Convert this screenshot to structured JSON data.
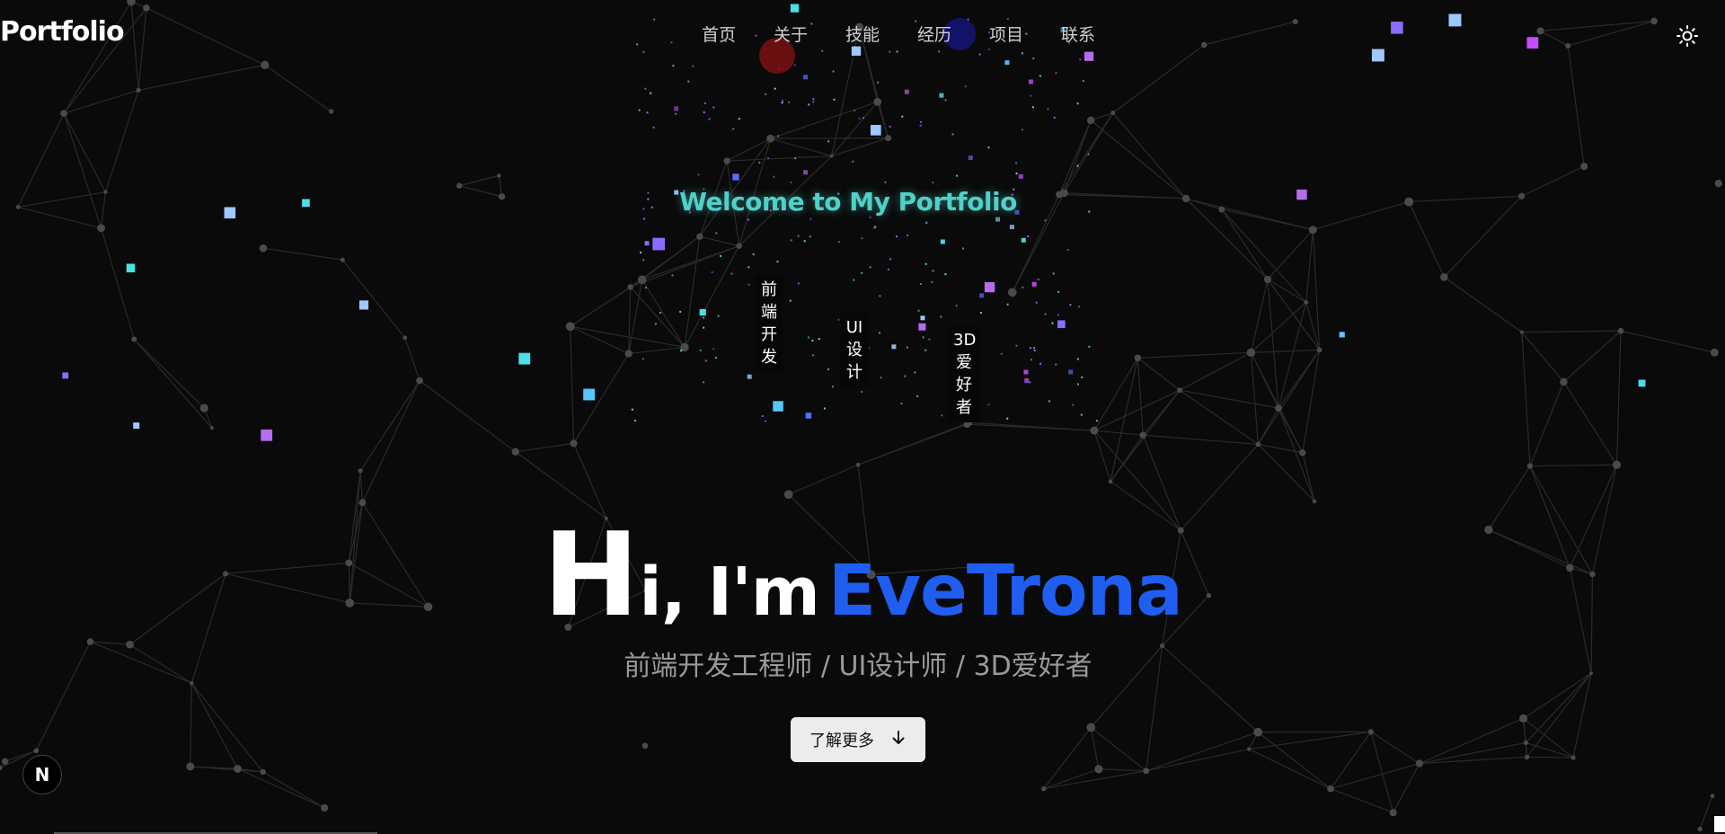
{
  "header": {
    "logo": "Portfolio",
    "nav": [
      "首页",
      "关于",
      "技能",
      "经历",
      "项目",
      "联系"
    ],
    "theme_toggle_icon": "sun-icon"
  },
  "intro": {
    "welcome": "Welcome to My Portfolio",
    "tags": [
      "前端开发",
      "UI设计",
      "3D爱好者"
    ]
  },
  "hero": {
    "greeting_h": "H",
    "greeting_rest": "i, I'm",
    "name": "EveTrona",
    "subtitle": "前端开发工程师 / UI设计师 / 3D爱好者",
    "cta_label": "了解更多",
    "cta_icon": "arrow-down-icon"
  },
  "badge": {
    "letter": "N",
    "icon": "next-logo-icon"
  },
  "colors": {
    "background": "#0a0a0a",
    "accent_blue": "#1f5ef0",
    "welcome_teal": "#4fd0c8",
    "subtitle_gray": "#9a9a9a"
  }
}
